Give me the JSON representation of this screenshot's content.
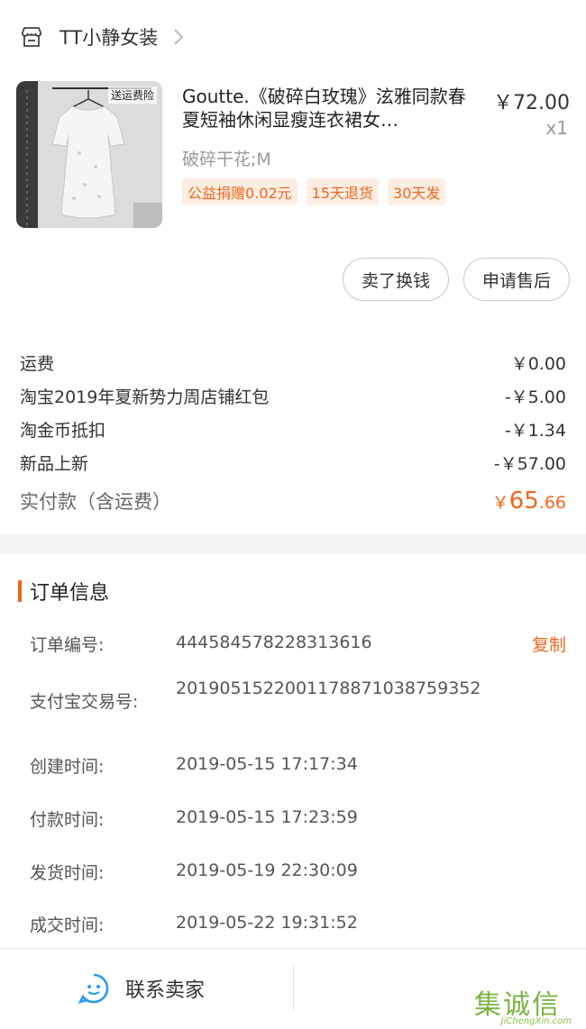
{
  "shop": {
    "name": "TT小静女装"
  },
  "product": {
    "title": "Goutte.《破碎白玫瑰》泫雅同款春夏短袖休闲显瘦连衣裙女…",
    "price": "￥72.00",
    "qty": "x1",
    "sku": "破碎干花;M",
    "thumb_tag": "送运费险",
    "tags": [
      "公益捐赠0.02元",
      "15天退货",
      "30天发"
    ]
  },
  "actions": {
    "sell": "卖了换钱",
    "aftersale": "申请售后"
  },
  "fees": {
    "shipping": {
      "label": "运费",
      "value": "￥0.00"
    },
    "redpacket": {
      "label": "淘宝2019年夏新势力周店铺红包",
      "value": "-￥5.00"
    },
    "taojinbi": {
      "label": "淘金币抵扣",
      "value": "-￥1.34"
    },
    "newitem": {
      "label": "新品上新",
      "value": "-￥57.00"
    },
    "total": {
      "label": "实付款（含运费）",
      "currency": "￥",
      "integer": "65",
      "decimal": ".66"
    }
  },
  "order_info": {
    "title": "订单信息",
    "copy": "复制",
    "rows": [
      {
        "label": "订单编号:",
        "value": "444584578228313616"
      },
      {
        "label": "支付宝交易号:",
        "value": "2019051522001178871038759352"
      },
      {
        "label": "创建时间:",
        "value": "2019-05-15 17:17:34"
      },
      {
        "label": "付款时间:",
        "value": "2019-05-15 17:23:59"
      },
      {
        "label": "发货时间:",
        "value": "2019-05-19 22:30:09"
      },
      {
        "label": "成交时间:",
        "value": "2019-05-22 19:31:52"
      }
    ]
  },
  "bottom": {
    "contact": "联系卖家"
  },
  "watermark": {
    "main": "集诚信",
    "sub": "JiChengXin.com"
  },
  "colors": {
    "accent": "#f0661b",
    "contact_icon": "#2a9bf0",
    "watermark": "#7cb342"
  }
}
